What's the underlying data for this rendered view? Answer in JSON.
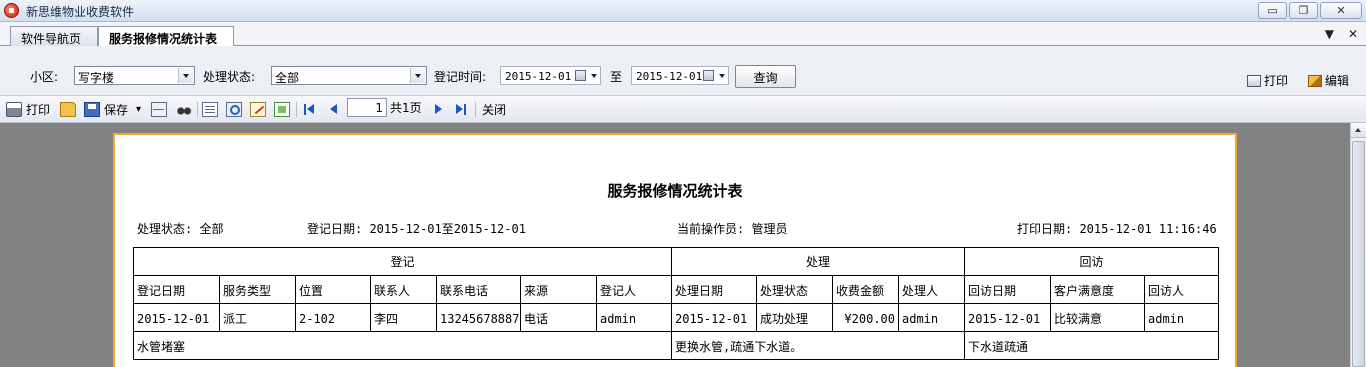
{
  "window": {
    "title": "新思维物业收费软件",
    "buttons": {
      "minimize": "▭",
      "restore": "❐",
      "close": "✕"
    }
  },
  "tabs": [
    {
      "label": "软件导航页"
    },
    {
      "label": "服务报修情况统计表"
    }
  ],
  "tab_actions": {
    "dropdown": "▼",
    "close": "✕"
  },
  "filters": {
    "area_label": "小区:",
    "area_value": "写字楼",
    "status_label": "处理状态:",
    "status_value": "全部",
    "date_label": "登记时间:",
    "date_from": "2015-12-01",
    "to_label": "至",
    "date_to": "2015-12-01",
    "query_button": "查询",
    "print_button": "打印",
    "edit_button": "编辑"
  },
  "toolbar": {
    "print": "打印",
    "save": "保存",
    "save_dropdown": "▾",
    "page_current": "1",
    "page_total": "共1页",
    "close": "关闭"
  },
  "report": {
    "title": "服务报修情况统计表",
    "status": "处理状态: 全部",
    "date_range": "登记日期: 2015-12-01至2015-12-01",
    "operator": "当前操作员: 管理员",
    "print_date": "打印日期: 2015-12-01 11:16:46",
    "groups": [
      "登记",
      "处理",
      "回访"
    ],
    "headers": [
      "登记日期",
      "服务类型",
      "位置",
      "联系人",
      "联系电话",
      "来源",
      "登记人",
      "处理日期",
      "处理状态",
      "收费金额",
      "处理人",
      "回访日期",
      "客户满意度",
      "回访人"
    ],
    "row": [
      "2015-12-01",
      "派工",
      "2-102",
      "李四",
      "13245678887",
      "电话",
      "admin",
      "2015-12-01",
      "成功处理",
      "¥200.00",
      "admin",
      "2015-12-01",
      "比较满意",
      "admin"
    ],
    "notes": {
      "register": "水管堵塞",
      "process": "更换水管,疏通下水道。",
      "visit": "下水道疏通"
    }
  }
}
